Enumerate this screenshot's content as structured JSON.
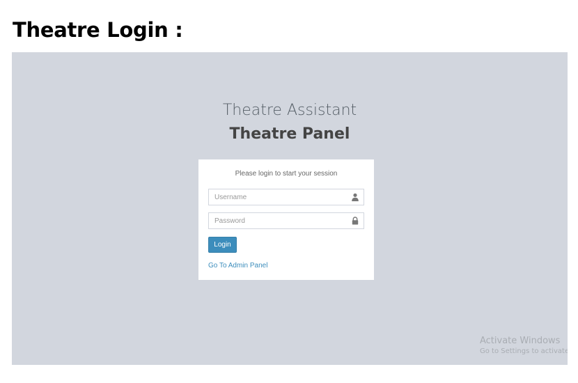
{
  "document": {
    "heading": "Theatre Login :"
  },
  "brand": {
    "subtitle": "Theatre Assistant",
    "title": "Theatre Panel"
  },
  "login_box": {
    "message": "Please login to start your session",
    "username": {
      "value": "",
      "placeholder": "Username",
      "icon": "user-icon"
    },
    "password": {
      "value": "",
      "placeholder": "Password",
      "icon": "lock-icon"
    },
    "login_button": "Login",
    "admin_link": "Go To Admin Panel"
  },
  "watermark": {
    "title": "Activate Windows",
    "subtitle": "Go to Settings to activate Windows."
  },
  "colors": {
    "page_background": "#d2d6de",
    "accent": "#3c8dbc",
    "box_background": "#ffffff"
  }
}
